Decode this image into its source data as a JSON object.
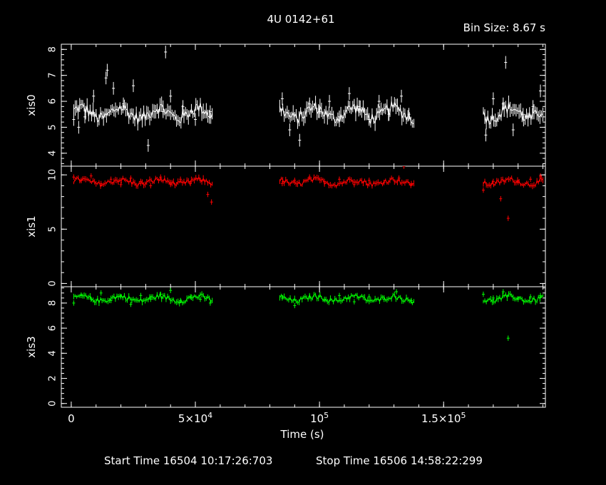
{
  "header": {
    "title": "4U 0142+61",
    "bin_size": "Bin Size: 8.67 s"
  },
  "footer": {
    "start_time": "Start Time 16504 10:17:26:703",
    "stop_time": "Stop Time 16506 14:58:22:299"
  },
  "colors": {
    "background": "#000000",
    "axes": "#ffffff",
    "xis0": "#ffffff",
    "xis1": "#ff0000",
    "xis3": "#00ff00"
  },
  "chart_data": {
    "type": "line",
    "xlabel": "Time (s)",
    "xlim": [
      -4000,
      191000
    ],
    "x_ticks": [
      {
        "value": 0,
        "label": "0"
      },
      {
        "value": 50000,
        "label": "5×10",
        "sup": "4"
      },
      {
        "value": 100000,
        "label": "10",
        "sup": "5"
      },
      {
        "value": 150000,
        "label": "1.5×10",
        "sup": "5"
      }
    ],
    "gti_segments": [
      [
        1000,
        57000
      ],
      [
        84000,
        138000
      ],
      [
        166000,
        190000
      ]
    ],
    "panels": [
      {
        "ylabel": "xis0",
        "ylim": [
          3.5,
          8.2
        ],
        "yticks": [
          4,
          5,
          6,
          7,
          8
        ],
        "color": "#ffffff",
        "series": {
          "name": "xis0",
          "mean": 5.55,
          "scatter": 0.35,
          "points": [
            [
              1000,
              5.3
            ],
            [
              3000,
              5.0
            ],
            [
              5500,
              5.4
            ],
            [
              9000,
              6.2
            ],
            [
              14000,
              6.9
            ],
            [
              14500,
              7.2
            ],
            [
              17000,
              6.5
            ],
            [
              21000,
              5.9
            ],
            [
              25000,
              6.6
            ],
            [
              31000,
              4.3
            ],
            [
              37000,
              5.6
            ],
            [
              38000,
              7.9
            ],
            [
              40000,
              6.2
            ],
            [
              45000,
              5.8
            ],
            [
              50000,
              5.3
            ],
            [
              56000,
              5.6
            ],
            [
              85000,
              6.1
            ],
            [
              88000,
              4.9
            ],
            [
              92000,
              4.5
            ],
            [
              96000,
              5.9
            ],
            [
              100000,
              5.6
            ],
            [
              104000,
              6.0
            ],
            [
              108000,
              5.4
            ],
            [
              112000,
              6.3
            ],
            [
              116000,
              5.8
            ],
            [
              120000,
              5.3
            ],
            [
              124000,
              6.0
            ],
            [
              128000,
              5.5
            ],
            [
              133000,
              6.2
            ],
            [
              136000,
              5.5
            ],
            [
              167000,
              4.7
            ],
            [
              170000,
              6.1
            ],
            [
              174000,
              5.9
            ],
            [
              175000,
              7.5
            ],
            [
              178000,
              4.9
            ],
            [
              182000,
              5.5
            ],
            [
              186000,
              5.8
            ],
            [
              189000,
              6.4
            ]
          ]
        }
      },
      {
        "ylabel": "xis1",
        "ylim": [
          -0.3,
          10.8
        ],
        "yticks": [
          0,
          5,
          10
        ],
        "color": "#ff0000",
        "series": {
          "name": "xis1",
          "mean": 9.35,
          "scatter": 0.35,
          "points": [
            [
              1000,
              9.8
            ],
            [
              4000,
              9.5
            ],
            [
              8000,
              9.9
            ],
            [
              12000,
              9.2
            ],
            [
              16000,
              9.6
            ],
            [
              20000,
              9.1
            ],
            [
              24000,
              9.7
            ],
            [
              28000,
              9.4
            ],
            [
              32000,
              9.0
            ],
            [
              36000,
              9.8
            ],
            [
              40000,
              9.3
            ],
            [
              44000,
              9.6
            ],
            [
              48000,
              9.2
            ],
            [
              52000,
              9.5
            ],
            [
              55000,
              8.2
            ],
            [
              56500,
              7.5
            ],
            [
              85000,
              9.2
            ],
            [
              90000,
              9.5
            ],
            [
              96000,
              9.8
            ],
            [
              102000,
              9.4
            ],
            [
              108000,
              9.6
            ],
            [
              114000,
              9.1
            ],
            [
              120000,
              9.5
            ],
            [
              126000,
              9.3
            ],
            [
              132000,
              9.7
            ],
            [
              134000,
              10.8
            ],
            [
              137000,
              9.2
            ],
            [
              166000,
              8.6
            ],
            [
              170000,
              9.4
            ],
            [
              173000,
              7.8
            ],
            [
              176000,
              6.0
            ],
            [
              180000,
              9.3
            ],
            [
              185000,
              9.6
            ],
            [
              189000,
              9.9
            ]
          ]
        }
      },
      {
        "ylabel": "xis3",
        "ylim": [
          -0.3,
          9.3
        ],
        "yticks": [
          0,
          2,
          4,
          6,
          8
        ],
        "color": "#00ff00",
        "series": {
          "name": "xis3",
          "mean": 8.35,
          "scatter": 0.3,
          "points": [
            [
              1000,
              8.0
            ],
            [
              4000,
              8.6
            ],
            [
              8000,
              8.3
            ],
            [
              12000,
              8.8
            ],
            [
              16000,
              8.2
            ],
            [
              20000,
              8.5
            ],
            [
              24000,
              7.9
            ],
            [
              28000,
              8.6
            ],
            [
              32000,
              8.3
            ],
            [
              36000,
              8.7
            ],
            [
              40000,
              9.0
            ],
            [
              44000,
              8.2
            ],
            [
              48000,
              8.5
            ],
            [
              52000,
              8.3
            ],
            [
              56000,
              8.0
            ],
            [
              85000,
              8.4
            ],
            [
              90000,
              7.8
            ],
            [
              96000,
              8.5
            ],
            [
              102000,
              8.3
            ],
            [
              108000,
              8.6
            ],
            [
              114000,
              8.1
            ],
            [
              120000,
              8.5
            ],
            [
              126000,
              8.3
            ],
            [
              131000,
              8.9
            ],
            [
              137000,
              8.2
            ],
            [
              166000,
              8.7
            ],
            [
              170000,
              8.4
            ],
            [
              174000,
              8.9
            ],
            [
              176000,
              5.2
            ],
            [
              180000,
              8.3
            ],
            [
              185000,
              8.5
            ],
            [
              189000,
              8.6
            ]
          ]
        }
      }
    ]
  }
}
